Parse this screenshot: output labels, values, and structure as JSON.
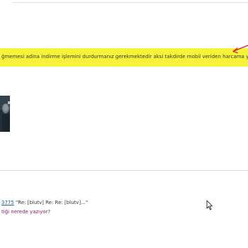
{
  "banner": {
    "text": "ğmemesi adina indirme işlemini durdurmanız gerekmektedir aksi takdirde mobil veriden harcama y",
    "background_color": "#f7f33a",
    "arrow_color": "#e0202a"
  },
  "thumbnail": {
    "icon": "video-thumbnail"
  },
  "post": {
    "link_text": "3775",
    "title_text": " \"Re: [blutv] Re: Re: [blutv]...\"",
    "question_text": "tiği nerede yazıyor?"
  },
  "cursor": {
    "icon": "mouse-pointer"
  }
}
